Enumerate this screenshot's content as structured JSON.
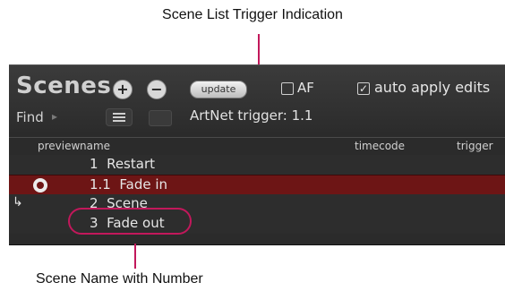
{
  "callouts": {
    "top": "Scene List Trigger Indication",
    "bottom": "Scene Name with Number"
  },
  "panel": {
    "title": "Scenes",
    "add_button": "+",
    "remove_button": "−",
    "update_button": "update",
    "af_label": "AF",
    "af_checked": false,
    "auto_apply_label": "auto apply edits",
    "auto_apply_checked": true,
    "check_mark": "✓",
    "find_label": "Find",
    "find_arrow": "▸",
    "artnet_trigger": "ArtNet trigger: 1.1"
  },
  "table": {
    "headers": {
      "preview": "preview",
      "name": "name",
      "timecode": "timecode",
      "trigger": "trigger"
    },
    "rows": [
      {
        "label": "1  Restart",
        "selected": false,
        "preview": false,
        "follow": false
      },
      {
        "label": "1.1  Fade in",
        "selected": true,
        "preview": true,
        "follow": false
      },
      {
        "label": "2  Scene",
        "selected": false,
        "preview": false,
        "follow": true
      },
      {
        "label": "3  Fade out",
        "selected": false,
        "preview": false,
        "follow": false
      }
    ],
    "follow_arrow": "↳"
  },
  "colors": {
    "callout_accent": "#c2185b",
    "selected_row": "#6d1515",
    "panel_background": "#2b2b2b"
  },
  "icons": [
    "add-icon",
    "remove-icon",
    "list-icon",
    "record-icon",
    "follow-arrow-icon"
  ]
}
